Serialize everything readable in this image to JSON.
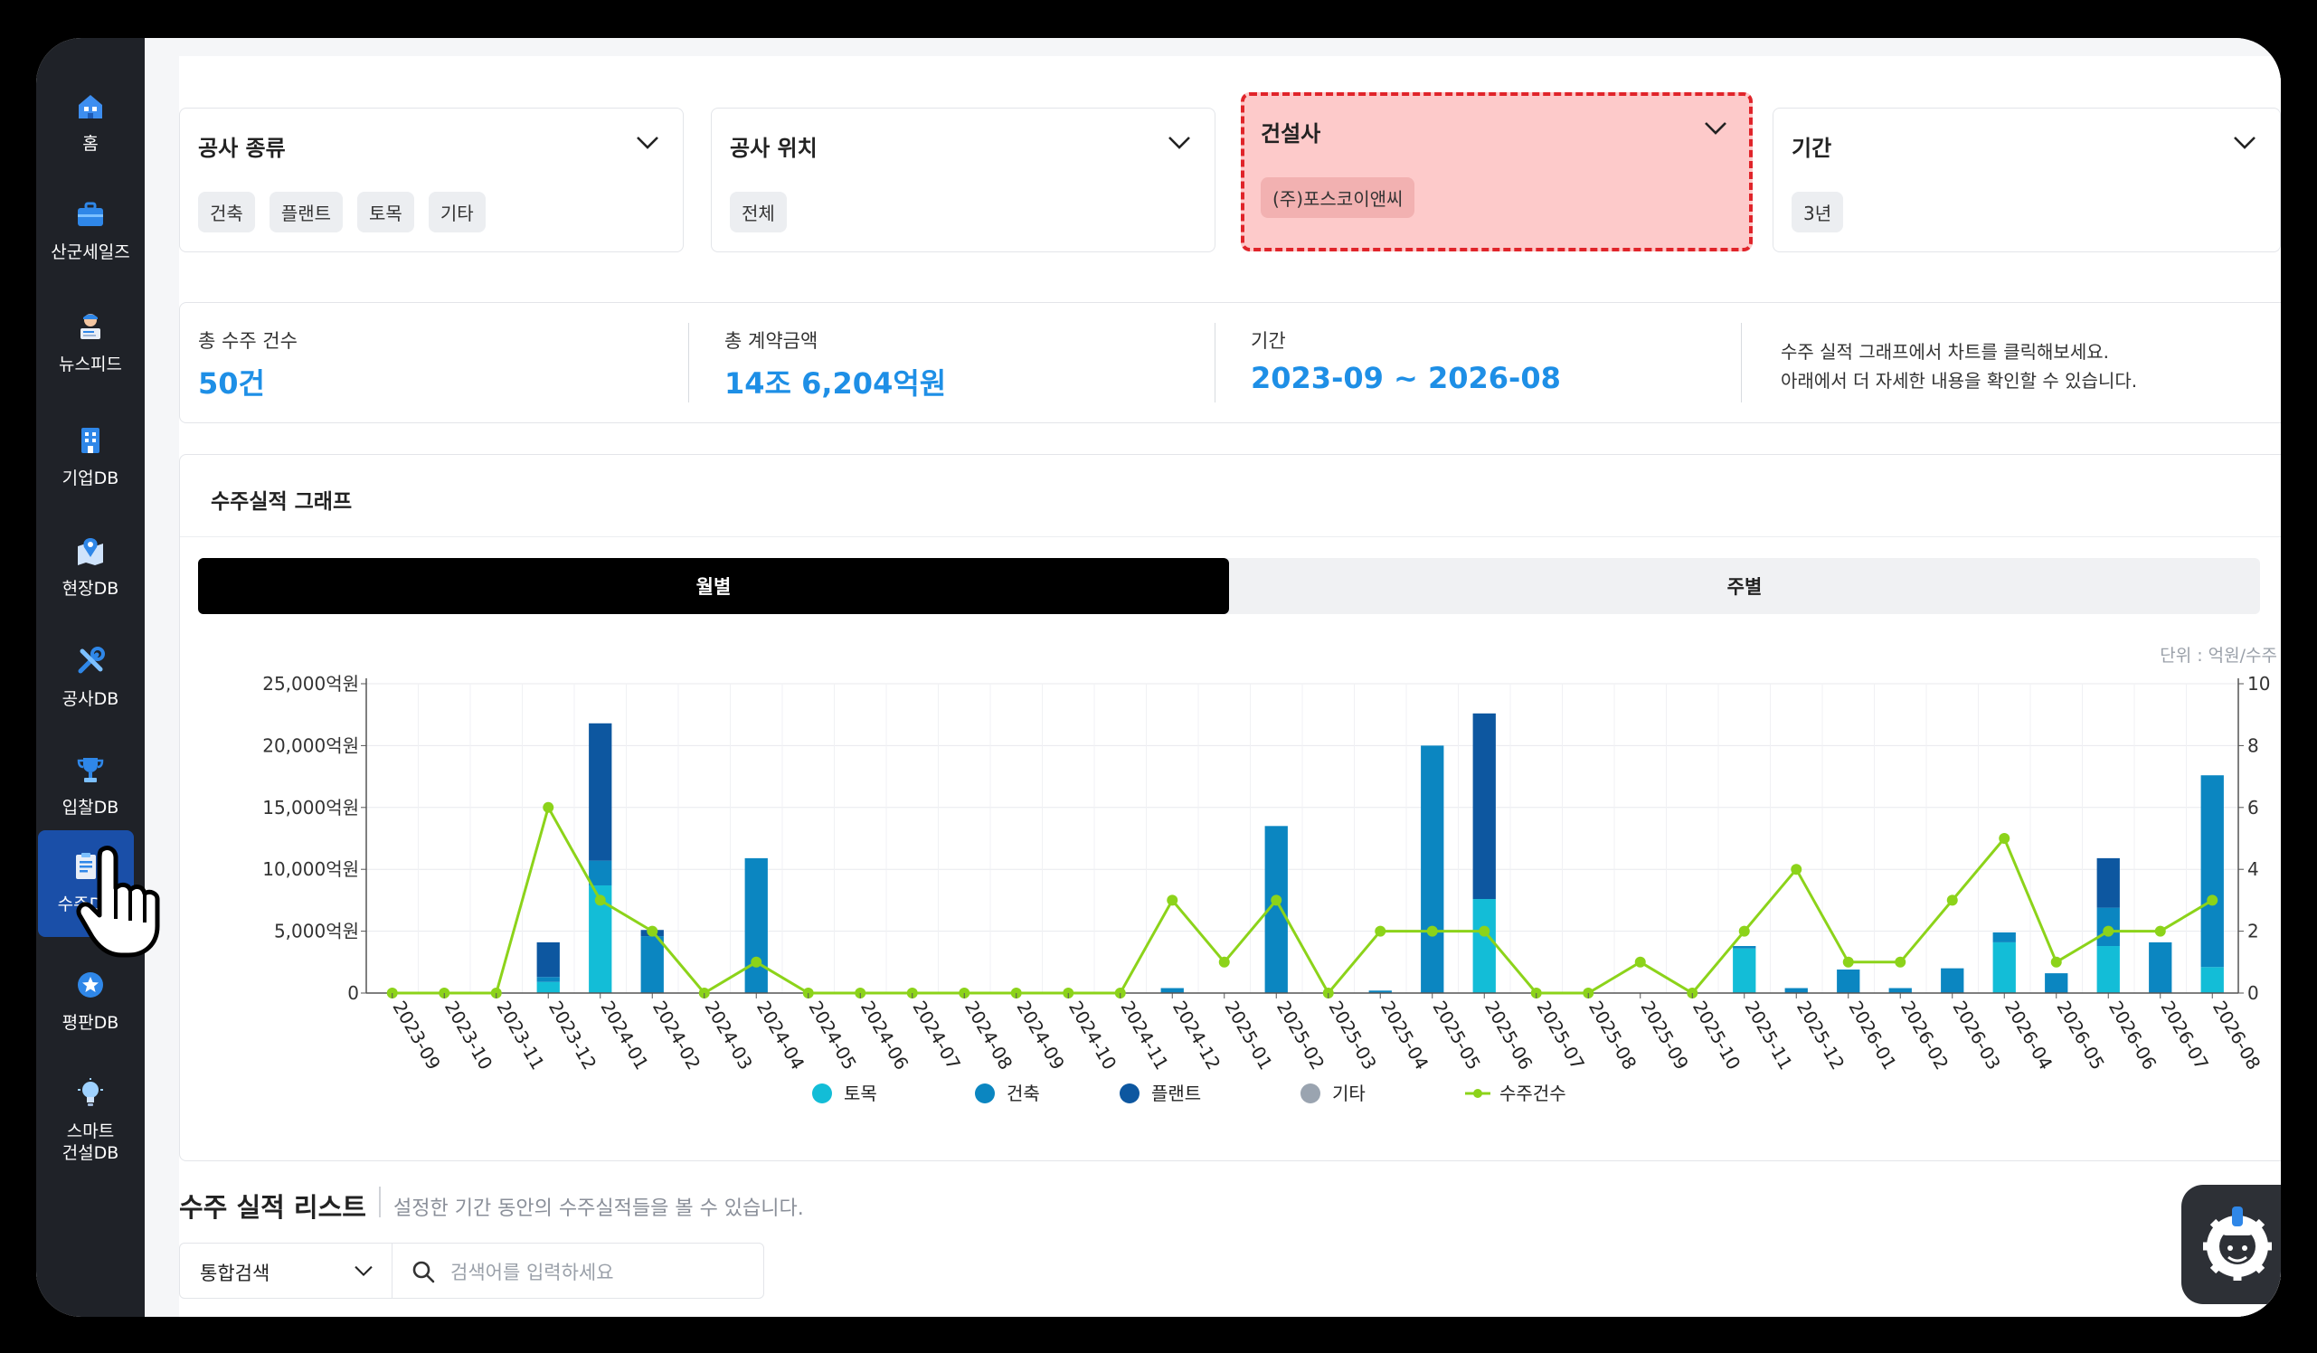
{
  "sidebar": {
    "items": [
      {
        "label": "홈",
        "icon": "home-icon"
      },
      {
        "label": "산군세일즈",
        "icon": "briefcase-icon"
      },
      {
        "label": "뉴스피드",
        "icon": "newsreader-icon"
      },
      {
        "label": "기업DB",
        "icon": "building-icon"
      },
      {
        "label": "현장DB",
        "icon": "map-pin-icon"
      },
      {
        "label": "공사DB",
        "icon": "tools-icon"
      },
      {
        "label": "입찰DB",
        "icon": "trophy-icon"
      },
      {
        "label": "수주DB",
        "icon": "clipboard-icon",
        "active": true
      },
      {
        "label": "평판DB",
        "icon": "star-badge-icon"
      },
      {
        "label": "스마트\n건설DB",
        "icon": "lightbulb-icon"
      }
    ]
  },
  "filters": [
    {
      "title": "공사 종류",
      "chips": [
        "건축",
        "플랜트",
        "토목",
        "기타"
      ]
    },
    {
      "title": "공사 위치",
      "chips": [
        "전체"
      ]
    },
    {
      "title": "건설사",
      "chips": [
        "(주)포스코이앤씨"
      ],
      "highlighted": true
    },
    {
      "title": "기간",
      "chips": [
        "3년"
      ]
    }
  ],
  "stats": {
    "total_count_label": "총 수주 건수",
    "total_count_value": "50건",
    "total_amount_label": "총 계약금액",
    "total_amount_value": "14조 6,204억원",
    "period_label": "기간",
    "period_value": "2023-09 ~ 2026-08",
    "hint_line1": "수주 실적 그래프에서 차트를 클릭해보세요.",
    "hint_line2": "아래에서 더 자세한 내용을 확인할 수 있습니다."
  },
  "chart_section": {
    "title": "수주실적 그래프",
    "tabs": [
      "월별",
      "주별"
    ],
    "active_tab": 0,
    "unit_label": "단위 : 억원/수주 건수"
  },
  "chart_data": {
    "type": "bar",
    "categories": [
      "2023-09",
      "2023-10",
      "2023-11",
      "2023-12",
      "2024-01",
      "2024-02",
      "2024-03",
      "2024-04",
      "2024-05",
      "2024-06",
      "2024-07",
      "2024-08",
      "2024-09",
      "2024-10",
      "2024-11",
      "2024-12",
      "2025-01",
      "2025-02",
      "2025-03",
      "2025-04",
      "2025-05",
      "2025-06",
      "2025-07",
      "2025-08",
      "2025-09",
      "2025-10",
      "2025-11",
      "2025-12",
      "2026-01",
      "2026-02",
      "2026-03",
      "2026-04",
      "2026-05",
      "2026-06",
      "2026-07",
      "2026-08"
    ],
    "series": [
      {
        "name": "토목",
        "color": "#13bdd7",
        "values": [
          0,
          0,
          0,
          900,
          8700,
          0,
          0,
          0,
          0,
          0,
          0,
          0,
          0,
          0,
          0,
          0,
          0,
          0,
          0,
          0,
          0,
          7600,
          0,
          0,
          0,
          0,
          3600,
          0,
          0,
          0,
          0,
          4100,
          0,
          3800,
          0,
          2100
        ]
      },
      {
        "name": "건축",
        "color": "#0b86c1",
        "values": [
          0,
          0,
          0,
          400,
          2000,
          4600,
          0,
          10900,
          0,
          0,
          0,
          0,
          0,
          0,
          0,
          400,
          0,
          13500,
          0,
          200,
          20000,
          0,
          0,
          0,
          0,
          0,
          200,
          400,
          1900,
          400,
          2000,
          800,
          1600,
          3100,
          4100,
          15500
        ]
      },
      {
        "name": "플랜트",
        "color": "#0d57a0",
        "values": [
          0,
          0,
          0,
          2800,
          11100,
          500,
          0,
          0,
          0,
          0,
          0,
          0,
          0,
          0,
          0,
          0,
          0,
          0,
          0,
          0,
          0,
          15000,
          0,
          0,
          0,
          0,
          0,
          0,
          0,
          0,
          0,
          0,
          0,
          4000,
          0,
          0
        ]
      },
      {
        "name": "기타",
        "color": "#9aa4b0",
        "values": [
          0,
          0,
          0,
          0,
          0,
          0,
          0,
          0,
          0,
          0,
          0,
          0,
          0,
          0,
          0,
          0,
          0,
          0,
          0,
          0,
          0,
          0,
          0,
          0,
          0,
          0,
          0,
          0,
          0,
          0,
          0,
          0,
          0,
          0,
          0,
          0
        ]
      }
    ],
    "line": {
      "name": "수주건수",
      "color": "#8cd31a",
      "values": [
        0,
        0,
        0,
        6,
        3,
        2,
        0,
        1,
        0,
        0,
        0,
        0,
        0,
        0,
        0,
        3,
        1,
        3,
        0,
        2,
        2,
        2,
        0,
        0,
        1,
        0,
        2,
        4,
        1,
        1,
        3,
        5,
        1,
        2,
        2,
        3
      ]
    },
    "y_left": {
      "min": 0,
      "max": 25000,
      "ticks": [
        "0",
        "5,000억원",
        "10,000억원",
        "15,000억원",
        "20,000억원",
        "25,000억원"
      ]
    },
    "y_right": {
      "min": 0,
      "max": 10,
      "ticks": [
        "0",
        "2",
        "4",
        "6",
        "8",
        "10"
      ]
    },
    "grid": true,
    "legend_position": "bottom"
  },
  "list_section": {
    "title": "수주 실적 리스트",
    "description": "설정한 기간 동안의 수주실적들을 볼 수 있습니다.",
    "search_type": "통합검색",
    "search_placeholder": "검색어를 입력하세요"
  }
}
